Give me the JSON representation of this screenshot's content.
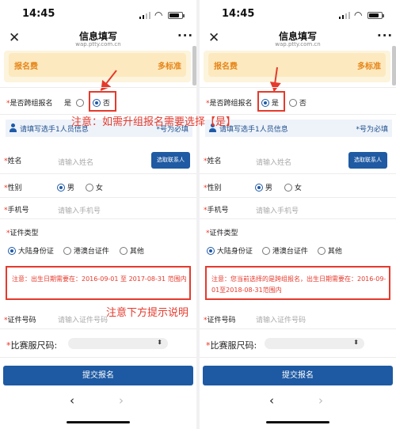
{
  "panels": [
    {
      "time": "14:45",
      "nav_title": "信息填写",
      "nav_sub": "wap.ptty.com.cn",
      "fee_label": "报名费",
      "fee_value": "多标准",
      "cross_group_label": "是否跨组报名",
      "opt_yes": "是",
      "opt_no": "否",
      "annotation_top": "注意：如需升组报名需要选择【是】",
      "info_text": "请填写选手1人员信息",
      "info_required": "*号为必填",
      "name_label": "姓名",
      "name_placeholder": "请输入姓名",
      "pick_contact": "选取联系人",
      "gender_label": "性别",
      "male": "男",
      "female": "女",
      "phone_label": "手机号",
      "phone_placeholder": "请输入手机号",
      "id_type_label": "证件类型",
      "id_mainland": "大陆身份证",
      "id_hkmt": "港澳台证件",
      "id_other": "其他",
      "notice": "注意：出生日期需要在：2016-09-01 至 2017-08-31 范围内",
      "annotation_bottom": "注意下方提示说明",
      "id_number_label": "证件号码",
      "id_number_placeholder": "请输入证件号码",
      "size_label": "比赛服尺码:",
      "submit_label": "提交报名"
    },
    {
      "time": "14:45",
      "nav_title": "信息填写",
      "nav_sub": "wap.ptty.com.cn",
      "fee_label": "报名费",
      "fee_value": "多标准",
      "cross_group_label": "是否跨组报名",
      "opt_yes": "是",
      "opt_no": "否",
      "info_text": "请填写选手1人员信息",
      "info_required": "*号为必填",
      "name_label": "姓名",
      "name_placeholder": "请输入姓名",
      "pick_contact": "选取联系人",
      "gender_label": "性别",
      "male": "男",
      "female": "女",
      "phone_label": "手机号",
      "phone_placeholder": "请输入手机号",
      "id_type_label": "证件类型",
      "id_mainland": "大陆身份证",
      "id_hkmt": "港澳台证件",
      "id_other": "其他",
      "notice": "注意：您当前选择的是跨组报名，出生日期需要在：2016-09-01至2018-08-31范围内",
      "id_number_label": "证件号码",
      "id_number_placeholder": "请输入证件号码",
      "size_label": "比赛服尺码:",
      "submit_label": "提交报名"
    }
  ],
  "colors": {
    "accent": "#1e5aa8",
    "annotation": "#e53a2c",
    "fee": "#e5861a"
  }
}
